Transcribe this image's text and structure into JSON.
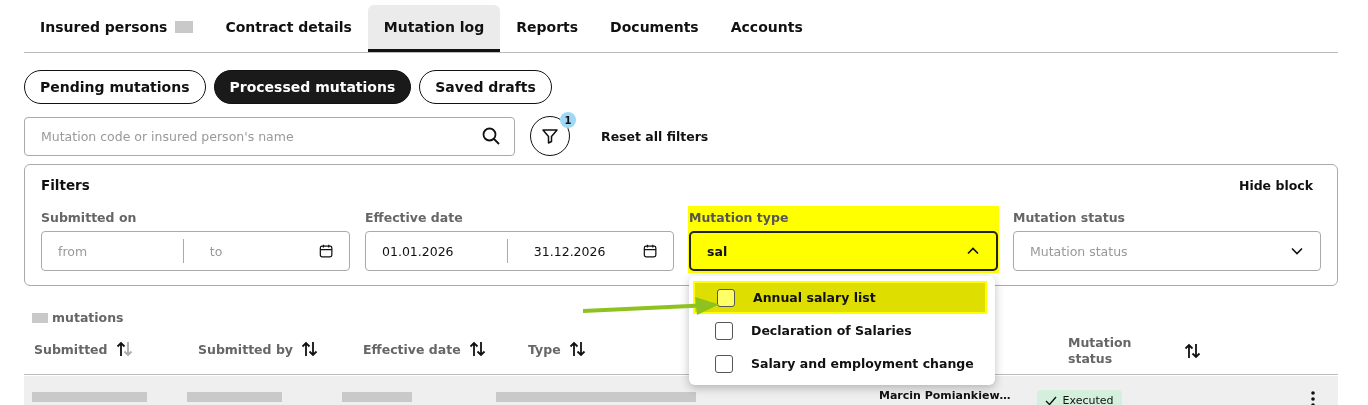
{
  "tabs": [
    {
      "label": "Insured persons",
      "selected": false,
      "blurred_count": true
    },
    {
      "label": "Contract details",
      "selected": false
    },
    {
      "label": "Mutation log",
      "selected": true
    },
    {
      "label": "Reports",
      "selected": false
    },
    {
      "label": "Documents",
      "selected": false
    },
    {
      "label": "Accounts",
      "selected": false
    }
  ],
  "views": [
    {
      "label": "Pending mutations",
      "selected": false
    },
    {
      "label": "Processed mutations",
      "selected": true
    },
    {
      "label": "Saved drafts",
      "selected": false
    }
  ],
  "search": {
    "placeholder": "Mutation code or insured person's name"
  },
  "filter_badge": "1",
  "reset_link": "Reset all filters",
  "filters": {
    "title": "Filters",
    "hide_link": "Hide block",
    "submitted_on": {
      "label": "Submitted on",
      "from_placeholder": "from",
      "to_placeholder": "to"
    },
    "effective_date": {
      "label": "Effective date",
      "from": "01.01.2026",
      "to": "31.12.2026"
    },
    "mutation_type": {
      "label": "Mutation type",
      "value": "sal",
      "expanded": true,
      "highlighted": true,
      "options": [
        {
          "label": "Annual salary list",
          "checked": false,
          "highlighted": true
        },
        {
          "label": "Declaration of Salaries",
          "checked": false,
          "highlighted": false
        },
        {
          "label": "Salary and employment change",
          "checked": false,
          "highlighted": false
        }
      ]
    },
    "mutation_status": {
      "label": "Mutation status",
      "placeholder": "Mutation status"
    }
  },
  "count_label": "mutations",
  "table": {
    "columns": [
      {
        "label": "Submitted",
        "sorted": true
      },
      {
        "label": "Submitted by",
        "sorted": false
      },
      {
        "label": "Effective date",
        "sorted": false
      },
      {
        "label": "Type",
        "sorted": false
      },
      {
        "label": "Mutation status",
        "sorted": false
      }
    ],
    "rows": [
      {
        "person": "Marcin Pomiankiew…",
        "status": "Executed"
      }
    ]
  }
}
